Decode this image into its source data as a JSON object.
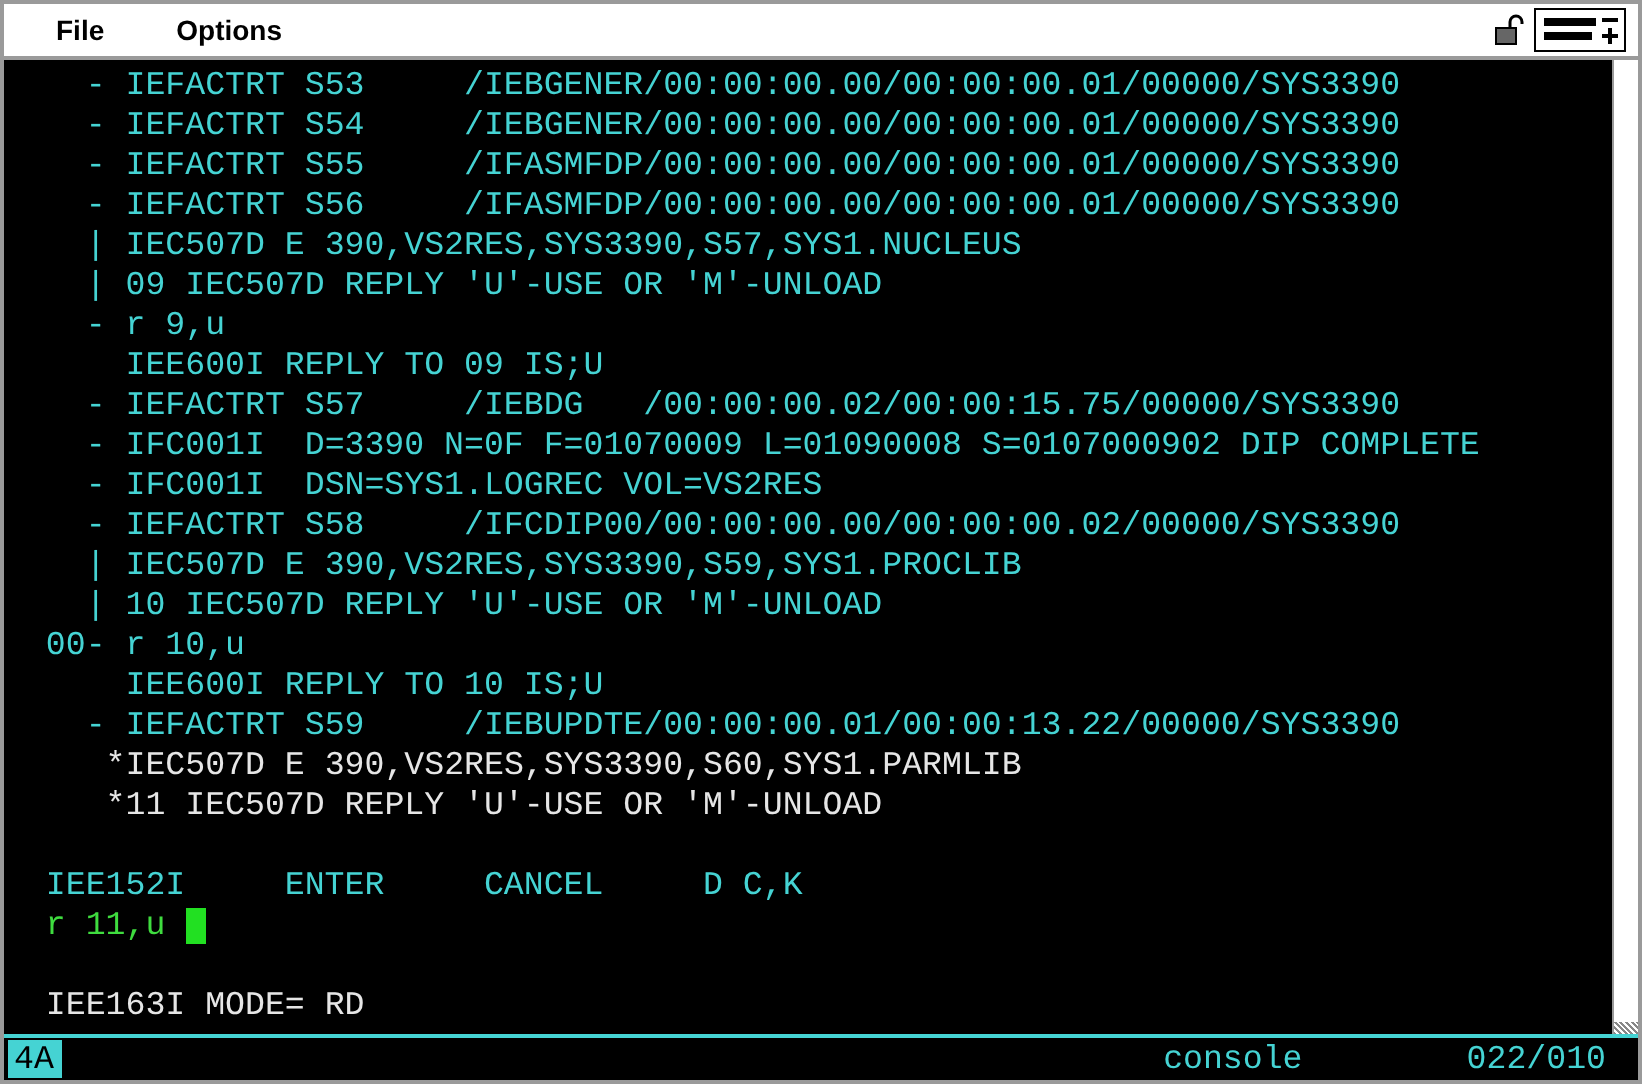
{
  "menu": [
    {
      "label": "File"
    },
    {
      "label": "Options"
    }
  ],
  "messages": [
    {
      "marker": "-",
      "text": "IEFACTRT S53     /IEBGENER/00:00:00.00/00:00:00.01/00000/SYS3390",
      "kind": "info"
    },
    {
      "marker": "-",
      "text": "IEFACTRT S54     /IEBGENER/00:00:00.00/00:00:00.01/00000/SYS3390",
      "kind": "info"
    },
    {
      "marker": "-",
      "text": "IEFACTRT S55     /IFASMFDP/00:00:00.00/00:00:00.01/00000/SYS3390",
      "kind": "info"
    },
    {
      "marker": "-",
      "text": "IEFACTRT S56     /IFASMFDP/00:00:00.00/00:00:00.01/00000/SYS3390",
      "kind": "info"
    },
    {
      "marker": "|",
      "text": "IEC507D E 390,VS2RES,SYS3390,S57,SYS1.NUCLEUS",
      "kind": "info"
    },
    {
      "marker": "|",
      "text": "09 IEC507D REPLY 'U'-USE OR 'M'-UNLOAD",
      "kind": "info"
    },
    {
      "marker": "-",
      "text": "r 9,u",
      "kind": "info"
    },
    {
      "text": "IEE600I REPLY TO 09 IS;U",
      "kind": "info"
    },
    {
      "marker": "-",
      "text": "IEFACTRT S57     /IEBDG   /00:00:00.02/00:00:15.75/00000/SYS3390",
      "kind": "info"
    },
    {
      "marker": "-",
      "text": "IFC001I  D=3390 N=0F F=01070009 L=01090008 S=0107000902 DIP COMPLETE",
      "kind": "info"
    },
    {
      "marker": "-",
      "text": "IFC001I  DSN=SYS1.LOGREC VOL=VS2RES",
      "kind": "info"
    },
    {
      "marker": "-",
      "text": "IEFACTRT S58     /IFCDIP00/00:00:00.00/00:00:00.02/00000/SYS3390",
      "kind": "info"
    },
    {
      "marker": "|",
      "text": "IEC507D E 390,VS2RES,SYS3390,S59,SYS1.PROCLIB",
      "kind": "info"
    },
    {
      "marker": "|",
      "text": "10 IEC507D REPLY 'U'-USE OR 'M'-UNLOAD",
      "kind": "info"
    },
    {
      "marker": "00-",
      "text": "r 10,u",
      "kind": "info"
    },
    {
      "text": "IEE600I REPLY TO 10 IS;U",
      "kind": "info"
    },
    {
      "marker": "-",
      "text": "IEFACTRT S59     /IEBUPDTE/00:00:00.01/00:00:13.22/00000/SYS3390",
      "kind": "info"
    },
    {
      "text": "*IEC507D E 390,VS2RES,SYS3390,S60,SYS1.PARMLIB",
      "kind": "action"
    },
    {
      "text": "*11 IEC507D REPLY 'U'-USE OR 'M'-UNLOAD",
      "kind": "action"
    }
  ],
  "prompt": {
    "code": "IEE152I",
    "options": [
      "ENTER",
      "CANCEL",
      "D C,K"
    ]
  },
  "input": {
    "value": "r 11,u"
  },
  "mode_message": "IEE163I MODE= RD",
  "status_bar": {
    "indicator": "4A",
    "session": "console",
    "position": "022/010"
  }
}
